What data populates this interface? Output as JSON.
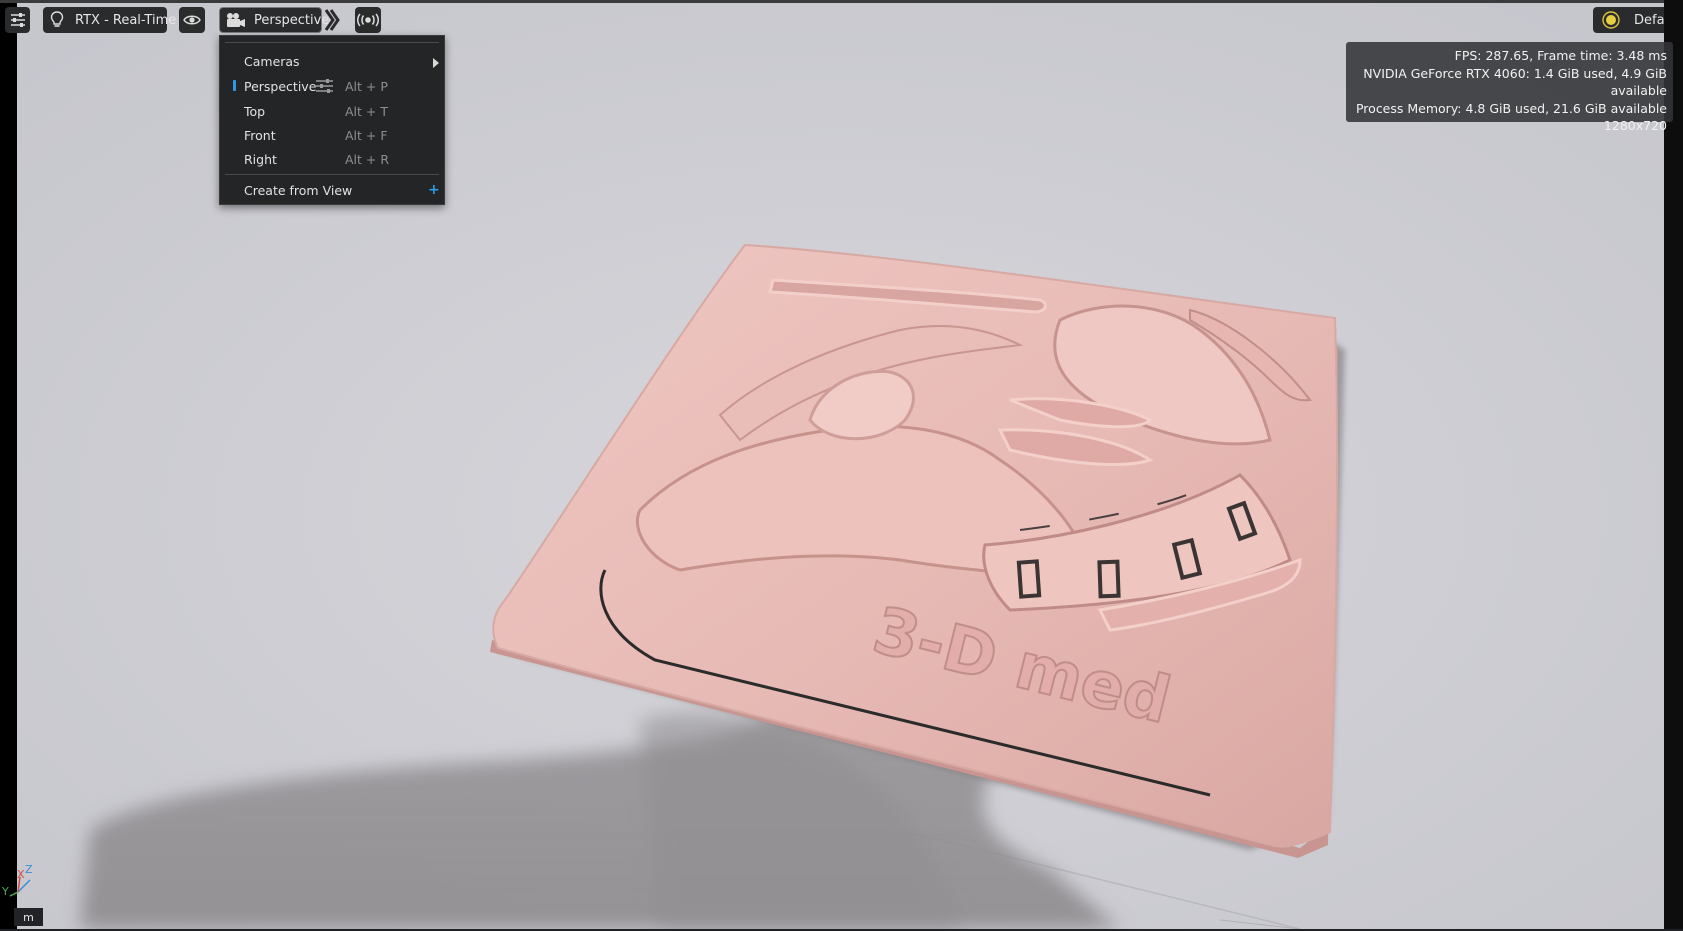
{
  "toolbar": {
    "renderer_label": "RTX - Real-Time",
    "camera_label": "Perspective",
    "lighting_label": "Default"
  },
  "stats": {
    "fps_line": "FPS: 287.65, Frame time: 3.48 ms",
    "gpu_line": "NVIDIA GeForce RTX 4060: 1.4 GiB used, 4.9 GiB available",
    "memory_line": "Process Memory: 4.8 GiB used, 21.6 GiB available",
    "resolution": "1280x720"
  },
  "camera_menu": {
    "cameras_label": "Cameras",
    "items": [
      {
        "label": "Perspective",
        "shortcut": "Alt + P",
        "selected": true
      },
      {
        "label": "Top",
        "shortcut": "Alt + T",
        "selected": false
      },
      {
        "label": "Front",
        "shortcut": "Alt + F",
        "selected": false
      },
      {
        "label": "Right",
        "shortcut": "Alt + R",
        "selected": false
      }
    ],
    "create_label": "Create from View",
    "create_icon": "+"
  },
  "axis_gizmo": {
    "x": "X",
    "y": "Y",
    "z": "Z"
  },
  "units": "m",
  "colors": {
    "selection_accent": "#2f9be8",
    "model": "#e8bbb6",
    "toolbar_bg": "#2a2b2d",
    "menu_bg": "#242527"
  }
}
